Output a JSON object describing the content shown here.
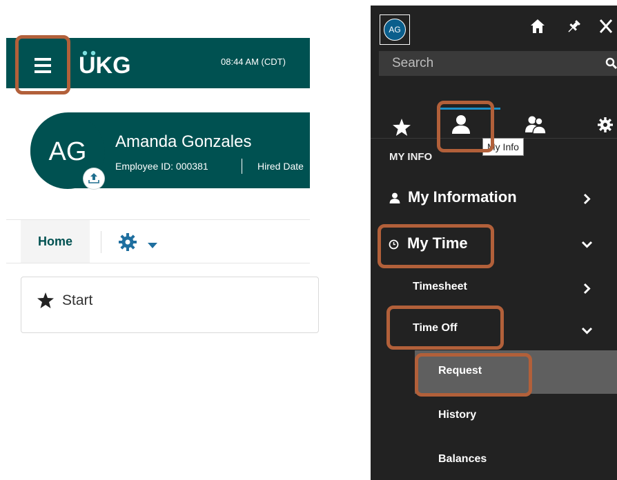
{
  "header": {
    "logo_text": "UKG",
    "clock": "08:44 AM (CDT)"
  },
  "profile": {
    "initials": "AG",
    "name": "Amanda Gonzales",
    "employee_id": "Employee ID: 000381",
    "hired_date": "Hired Date"
  },
  "tabs": {
    "home": "Home"
  },
  "start": {
    "label": "Start"
  },
  "nav": {
    "avatar_initials": "AG",
    "search_placeholder": "Search",
    "tooltip": "My Info",
    "section_header": "MY INFO",
    "items": {
      "my_information": "My Information",
      "my_time": "My Time",
      "timesheet": "Timesheet",
      "time_off": "Time Off",
      "request": "Request",
      "history": "History",
      "balances": "Balances"
    }
  },
  "colors": {
    "brand_teal": "#005151",
    "highlight": "#b2603a",
    "nav_bg": "#222222",
    "active_blue": "#1a8fc7"
  },
  "icons": [
    "hamburger-icon",
    "upload-icon",
    "gear-icon",
    "caret-down-icon",
    "star-icon",
    "home-icon",
    "pin-icon",
    "close-icon",
    "search-icon",
    "person-icon",
    "group-icon",
    "clock-icon",
    "chevron-right-icon",
    "chevron-down-icon"
  ]
}
